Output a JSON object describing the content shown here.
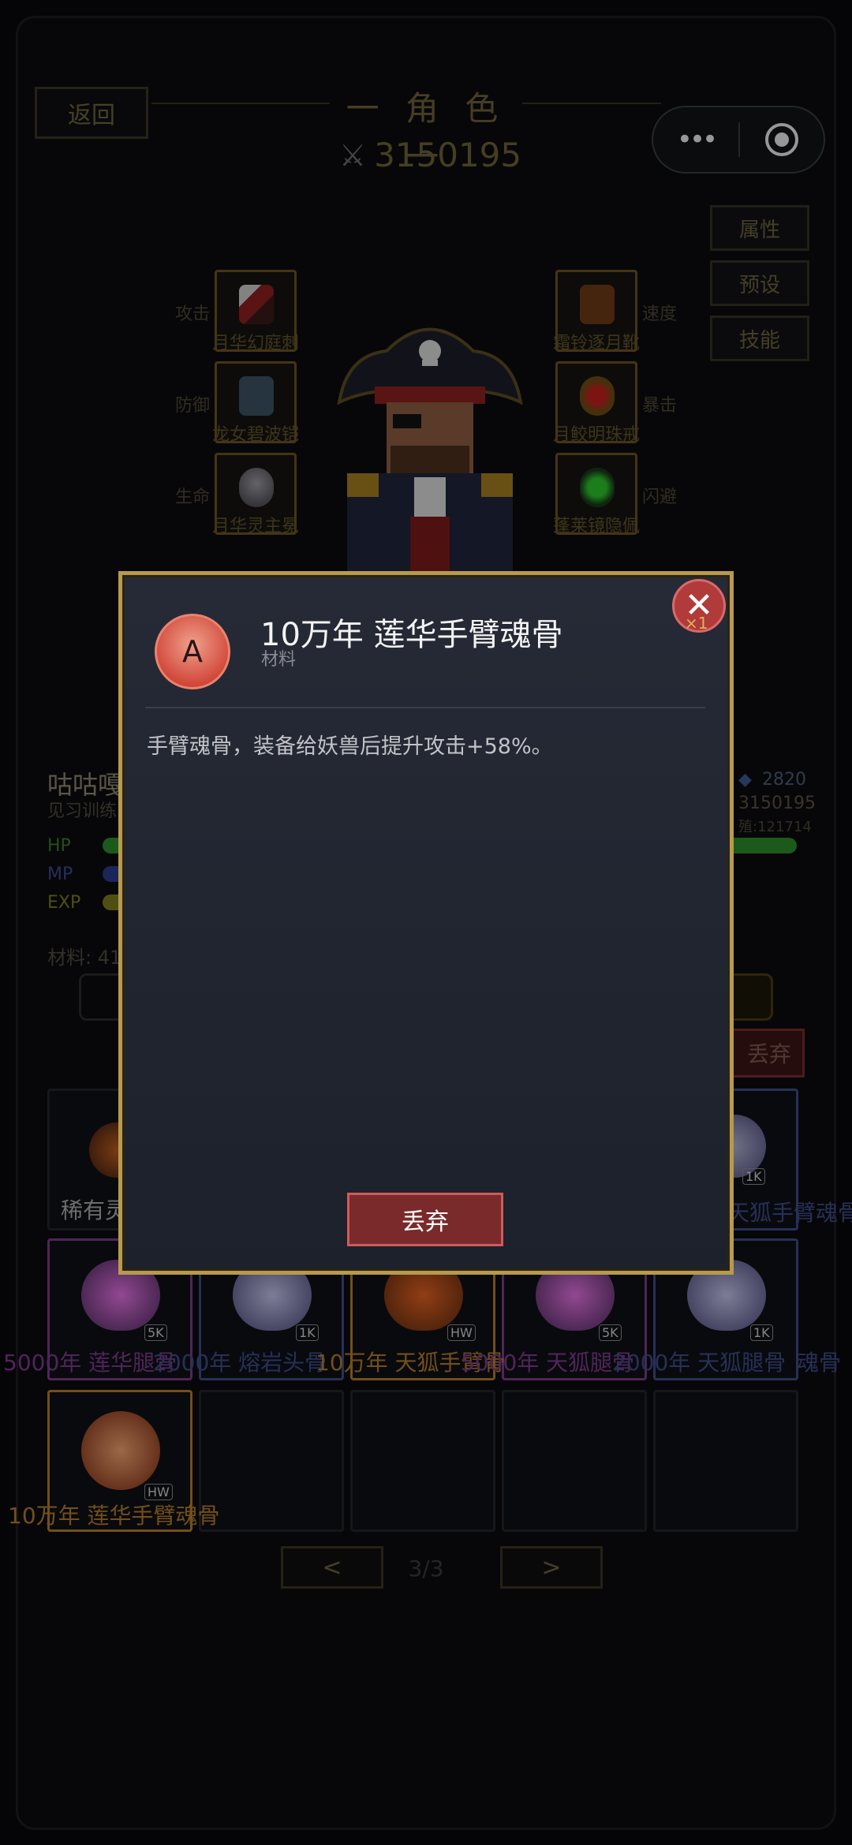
{
  "header": {
    "back_label": "返回",
    "title": "一 角 色 一",
    "power": "3150195"
  },
  "capsule": {
    "more_icon": "•••",
    "record_icon": "target-circle"
  },
  "side_tabs": [
    "属性",
    "预设",
    "技能"
  ],
  "equip_left": [
    {
      "stat": "攻击",
      "item": "月华幻庭刺"
    },
    {
      "stat": "防御",
      "item": "龙女碧波铠"
    },
    {
      "stat": "生命",
      "item": "月华灵主冕"
    }
  ],
  "equip_right": [
    {
      "stat": "速度",
      "item": "霜铃逐月靴"
    },
    {
      "stat": "暴击",
      "item": "月鲛明珠戒"
    },
    {
      "stat": "闪避",
      "item": "蓬莱镜隐佩"
    }
  ],
  "player": {
    "name": "咕咕嘎",
    "rank": "见习训练",
    "hp_label": "HP",
    "mp_label": "MP",
    "exp_label": "EXP",
    "diamonds": "2820",
    "power": "3150195",
    "extra": "殖:121714",
    "material": "材料: 41"
  },
  "bag": {
    "discard_label": "丢弃",
    "row1": [
      {
        "name": "稀有灵",
        "color": "#8a7550"
      },
      {
        "name": "",
        "color": "#5a5a8a"
      },
      {
        "name": "",
        "color": "#5a5a8a"
      },
      {
        "name": "",
        "color": "#5a5a8a"
      },
      {
        "name": "天狐手臂魂骨",
        "color": "#3c4a86"
      }
    ],
    "row2": [
      {
        "name": "5000年 莲华腿骨",
        "badge": "5K",
        "color": "#7a3a8a"
      },
      {
        "name": "2000年 熔岩头骨",
        "badge": "1K",
        "color": "#3c4a86"
      },
      {
        "name": "10万年 天狐手臂骨",
        "badge": "HW",
        "color": "#b07a2a"
      },
      {
        "name": "5000年 天狐腿骨",
        "badge": "5K",
        "color": "#7a3a8a"
      },
      {
        "name": "2000年 天狐腿骨",
        "badge": "1K",
        "color": "#3c4a86"
      }
    ],
    "row3_first": {
      "name": "10万年 莲华手臂魂骨",
      "badge": "HW",
      "color": "#b07a2a"
    },
    "row1_overflow": "天狐手臂魂骨",
    "row2_overflow": "魂骨"
  },
  "pager": {
    "prev": "<",
    "next": ">",
    "page": "3/3"
  },
  "modal": {
    "grade": "A",
    "name": "10万年 莲华手臂魂骨",
    "type": "材料",
    "description": "手臂魂骨，装备给妖兽后提升攻击+58%。",
    "count": "×1",
    "discard_label": "丢弃"
  },
  "colors": {
    "accent": "#b89a4e",
    "danger": "#b13a3a",
    "rare_purple": "#7a3a8a",
    "rare_blue": "#3c4a86",
    "legend_gold": "#b07a2a"
  }
}
